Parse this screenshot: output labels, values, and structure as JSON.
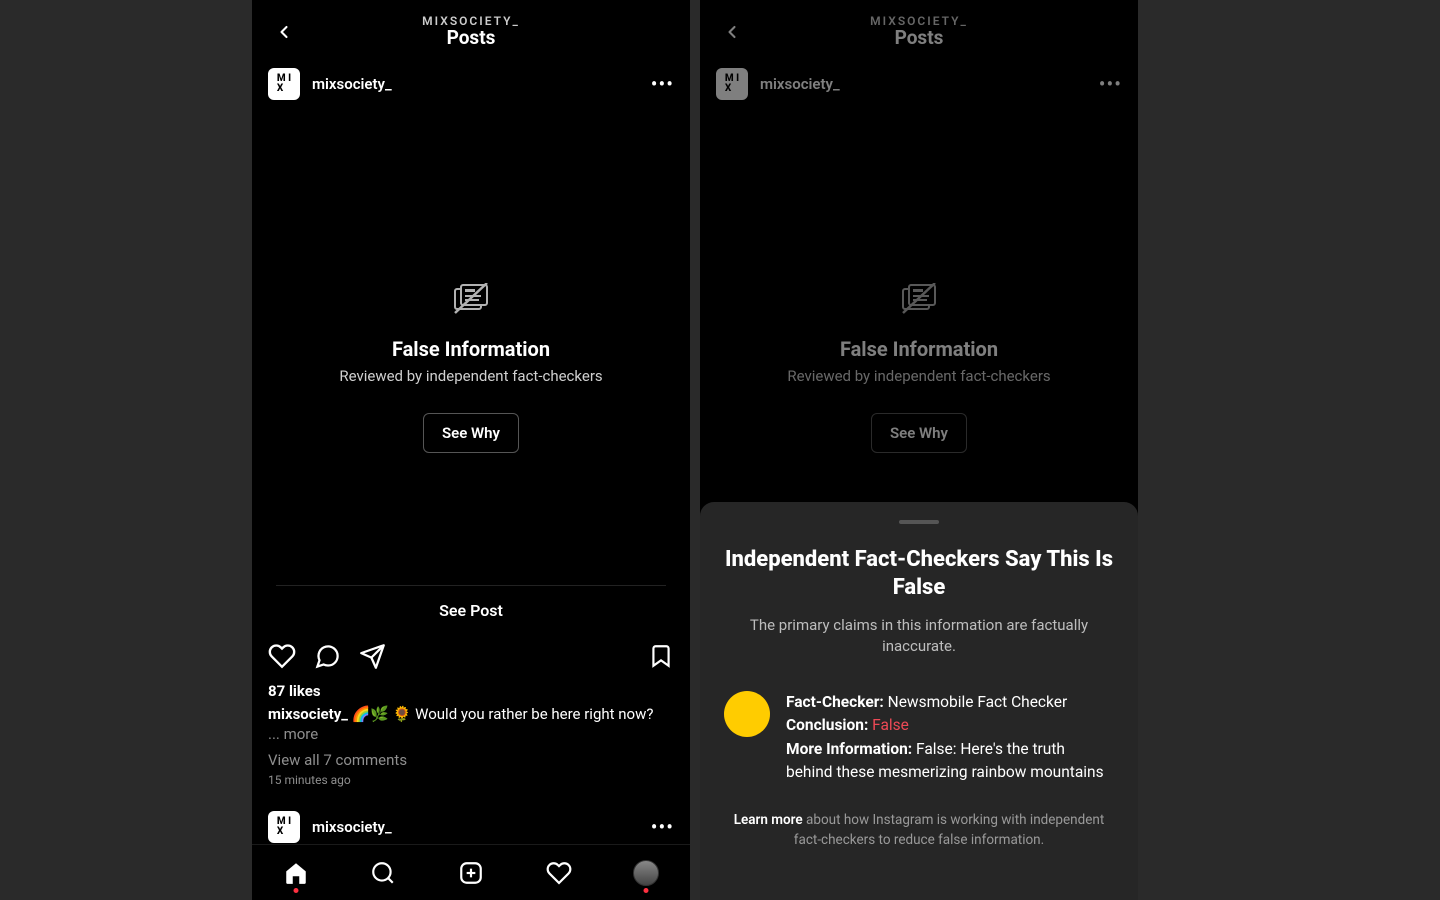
{
  "account": {
    "handle_upper": "MIXSOCIETY_",
    "section": "Posts"
  },
  "post": {
    "username": "mixsociety_",
    "avatar_initials_top": "M I",
    "avatar_initials_bot": "X",
    "false_info_title": "False Information",
    "false_info_sub": "Reviewed by independent fact-checkers",
    "see_why": "See Why",
    "see_post": "See Post",
    "likes": "87 likes",
    "caption_user": "mixsociety_",
    "caption_text": " 🌈🌿 🌻 Would you rather be here right now?",
    "caption_more_prefix": "... ",
    "caption_more": "more",
    "view_comments": "View all 7 comments",
    "time": "15 minutes ago"
  },
  "sheet": {
    "title": "Independent Fact-Checkers Say This Is False",
    "sub": "The primary claims in this information are factually inaccurate.",
    "labels": {
      "checker": "Fact-Checker:",
      "conclusion": "Conclusion:",
      "more_info": "More Information:"
    },
    "checker_name": "Newsmobile Fact Checker",
    "conclusion_value": "False",
    "more_info_text": "False: Here's the truth behind these mesmerizing rainbow mountains",
    "learn_more_label": "Learn more",
    "learn_more_rest": " about how Instagram is working with independent fact-checkers to reduce false information."
  }
}
